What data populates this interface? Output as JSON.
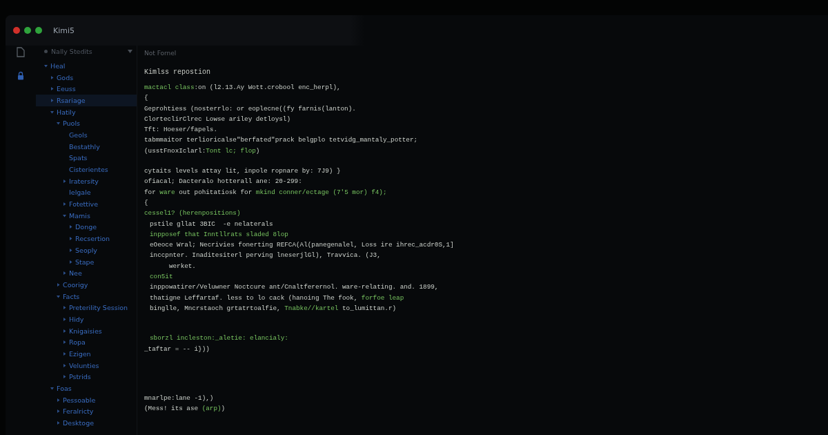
{
  "window": {
    "title": "Kimi5"
  },
  "sidebar": {
    "workspace": "Nally Stedits",
    "tree": [
      {
        "label": "Heal",
        "kind": "folder",
        "expanded": true,
        "selected": false,
        "children": [
          {
            "label": "Gods",
            "kind": "folder",
            "expanded": false,
            "selected": false
          },
          {
            "label": "Eeuss",
            "kind": "folder",
            "expanded": false,
            "selected": false
          },
          {
            "label": "Rsariage",
            "kind": "folder",
            "expanded": false,
            "selected": true
          },
          {
            "label": "Hatily",
            "kind": "folder",
            "expanded": true,
            "selected": false,
            "children": [
              {
                "label": "Puols",
                "kind": "folder",
                "expanded": true,
                "selected": false,
                "children": [
                  {
                    "label": "Geols",
                    "kind": "file",
                    "selected": false
                  },
                  {
                    "label": "Bestathly",
                    "kind": "file",
                    "selected": false
                  },
                  {
                    "label": "Spats",
                    "kind": "file",
                    "selected": false
                  },
                  {
                    "label": "Cisterientes",
                    "kind": "file",
                    "selected": false
                  },
                  {
                    "label": "Iratersity",
                    "kind": "folder",
                    "expanded": false,
                    "selected": false
                  },
                  {
                    "label": "Ielgale",
                    "kind": "file",
                    "selected": false
                  },
                  {
                    "label": "Fotettive",
                    "kind": "folder",
                    "expanded": false,
                    "selected": false
                  },
                  {
                    "label": "Mamis",
                    "kind": "folder",
                    "expanded": true,
                    "selected": false,
                    "children": [
                      {
                        "label": "Donge",
                        "kind": "folder",
                        "expanded": false,
                        "selected": false
                      },
                      {
                        "label": "Recsertion",
                        "kind": "folder",
                        "expanded": false,
                        "selected": false
                      },
                      {
                        "label": "Seoply",
                        "kind": "folder",
                        "expanded": false,
                        "selected": false
                      },
                      {
                        "label": "Stape",
                        "kind": "folder",
                        "expanded": false,
                        "selected": false
                      }
                    ]
                  },
                  {
                    "label": "Nee",
                    "kind": "folder",
                    "expanded": false,
                    "selected": false
                  }
                ]
              },
              {
                "label": "Coorigy",
                "kind": "folder",
                "expanded": false,
                "selected": false
              },
              {
                "label": "Facts",
                "kind": "folder",
                "expanded": true,
                "selected": false,
                "children": [
                  {
                    "label": "Preterility Session",
                    "kind": "folder",
                    "expanded": false,
                    "selected": false
                  },
                  {
                    "label": "Hidy",
                    "kind": "folder",
                    "expanded": false,
                    "selected": false
                  },
                  {
                    "label": "Knigaisies",
                    "kind": "folder",
                    "expanded": false,
                    "selected": false
                  },
                  {
                    "label": "Ropa",
                    "kind": "folder",
                    "expanded": false,
                    "selected": false
                  },
                  {
                    "label": "Ezigen",
                    "kind": "folder",
                    "expanded": false,
                    "selected": false
                  },
                  {
                    "label": "Velunties",
                    "kind": "folder",
                    "expanded": false,
                    "selected": false
                  },
                  {
                    "label": "Pstrids",
                    "kind": "folder",
                    "expanded": false,
                    "selected": false
                  }
                ]
              }
            ]
          },
          {
            "label": "Foas",
            "kind": "folder",
            "expanded": true,
            "selected": false,
            "children": [
              {
                "label": "Pessoable",
                "kind": "folder",
                "expanded": false,
                "selected": false
              },
              {
                "label": "Feralricty",
                "kind": "folder",
                "expanded": false,
                "selected": false
              },
              {
                "label": "Desktoge",
                "kind": "folder",
                "expanded": false,
                "selected": false
              }
            ]
          }
        ]
      }
    ]
  },
  "editor": {
    "breadcrumb": "Not Fornel",
    "heading": "Kimlss repostion",
    "lines": [
      {
        "kind": "code",
        "indented": false,
        "segments": [
          {
            "kind": "keyword",
            "text": "mactacl class"
          },
          {
            "kind": "plain",
            "text": ":on (l2.13.Ay Wott.crobool enc_herpl),"
          }
        ]
      },
      {
        "kind": "code",
        "indented": false,
        "segments": [
          {
            "kind": "plain",
            "text": "{"
          }
        ]
      },
      {
        "kind": "code",
        "indented": false,
        "segments": [
          {
            "kind": "plain",
            "text": "Geprohtiess (nosterrlo: or eoplecne((fy farnis(lanton)."
          }
        ]
      },
      {
        "kind": "code",
        "indented": false,
        "segments": [
          {
            "kind": "plain",
            "text": "ClorteclirClrec Lowse ariley detloysl)"
          }
        ]
      },
      {
        "kind": "code",
        "indented": false,
        "segments": [
          {
            "kind": "plain",
            "text": "Tft: Hoeser/fapels."
          }
        ]
      },
      {
        "kind": "code",
        "indented": false,
        "segments": [
          {
            "kind": "plain",
            "text": "tabmmaitor terlioricalse\"berfated\"prack belgplo tetvidg_mantaly_potter;"
          }
        ]
      },
      {
        "kind": "code",
        "indented": false,
        "segments": [
          {
            "kind": "plain",
            "text": "(usstFnoxIclarl:"
          },
          {
            "kind": "keyword",
            "text": "Tont lc; flop"
          },
          {
            "kind": "plain",
            "text": ")"
          }
        ]
      },
      {
        "kind": "blank"
      },
      {
        "kind": "code",
        "indented": false,
        "segments": [
          {
            "kind": "plain",
            "text": "cytaits levels attay lit, inpole ropnare by: 7J9) }"
          }
        ]
      },
      {
        "kind": "code",
        "indented": false,
        "segments": [
          {
            "kind": "plain",
            "text": "ofiacal; Dacteralo hotterall ane: 20-299:"
          }
        ]
      },
      {
        "kind": "code",
        "indented": false,
        "segments": [
          {
            "kind": "plain",
            "text": "for "
          },
          {
            "kind": "keyword",
            "text": "ware"
          },
          {
            "kind": "plain",
            "text": " out pohitatiosk for "
          },
          {
            "kind": "keyword",
            "text": "mkind conner/ectage (7'5 mor) f4);"
          }
        ]
      },
      {
        "kind": "code",
        "indented": false,
        "segments": [
          {
            "kind": "plain",
            "text": "{"
          }
        ]
      },
      {
        "kind": "code",
        "indented": false,
        "segments": [
          {
            "kind": "keyword",
            "text": "cessel1? (herenpositions)"
          }
        ]
      },
      {
        "kind": "code",
        "indented": true,
        "segments": [
          {
            "kind": "plain",
            "text": "pstile gllat 3BIC  -e nelaterals"
          }
        ]
      },
      {
        "kind": "code",
        "indented": true,
        "segments": [
          {
            "kind": "keyword",
            "text": "inpposef that Inntllrats sladed 8lop"
          }
        ]
      },
      {
        "kind": "code",
        "indented": true,
        "segments": [
          {
            "kind": "plain",
            "text": "eOeoce Wral; Necrivies fonerting REFCA(Al(panegenalel, Loss ire ihrec_acdr0S,1]"
          }
        ]
      },
      {
        "kind": "code",
        "indented": true,
        "segments": [
          {
            "kind": "plain",
            "text": "inccpnter. Inaditesiterl perving lneserjlGl), Travvica. (J3,"
          }
        ]
      },
      {
        "kind": "code",
        "indented": true,
        "segments": [
          {
            "kind": "plain",
            "text": "     werket."
          }
        ]
      },
      {
        "kind": "code",
        "indented": true,
        "segments": [
          {
            "kind": "keyword",
            "text": "con5it"
          }
        ]
      },
      {
        "kind": "code",
        "indented": true,
        "segments": [
          {
            "kind": "plain",
            "text": "inppowatirer/Veluwner Noctcure ant/Cnaltferernol. ware-relating. and. 1899,"
          }
        ]
      },
      {
        "kind": "code",
        "indented": true,
        "segments": [
          {
            "kind": "plain",
            "text": "thatigne Leffartaf. less to lo cack (hanoing The fook, "
          },
          {
            "kind": "keyword",
            "text": "forfoe leap"
          }
        ]
      },
      {
        "kind": "code",
        "indented": true,
        "segments": [
          {
            "kind": "plain",
            "text": "binglle, Mncrstaoch grtatrtoalfie, "
          },
          {
            "kind": "keyword",
            "text": "Tnabke//kartel"
          },
          {
            "kind": "plain",
            "text": " to_lumittan.r)"
          }
        ]
      },
      {
        "kind": "blank"
      },
      {
        "kind": "blank"
      },
      {
        "kind": "code",
        "indented": true,
        "segments": [
          {
            "kind": "keyword",
            "text": "sborzl incleston:_aletie: elancialy:"
          }
        ]
      },
      {
        "kind": "code",
        "indented": false,
        "segments": [
          {
            "kind": "plain",
            "text": "_taftar = -- i}))"
          }
        ]
      },
      {
        "kind": "blank"
      },
      {
        "kind": "blank"
      },
      {
        "kind": "blank"
      },
      {
        "kind": "blank"
      },
      {
        "kind": "code",
        "indented": false,
        "segments": [
          {
            "kind": "plain",
            "text": "mnarlpe:lane -1),)"
          }
        ]
      },
      {
        "kind": "code",
        "indented": false,
        "segments": [
          {
            "kind": "plain",
            "text": "(Mess! its ase "
          },
          {
            "kind": "keyword",
            "text": "(arp)"
          },
          {
            "kind": "plain",
            "text": ")"
          }
        ]
      }
    ]
  }
}
